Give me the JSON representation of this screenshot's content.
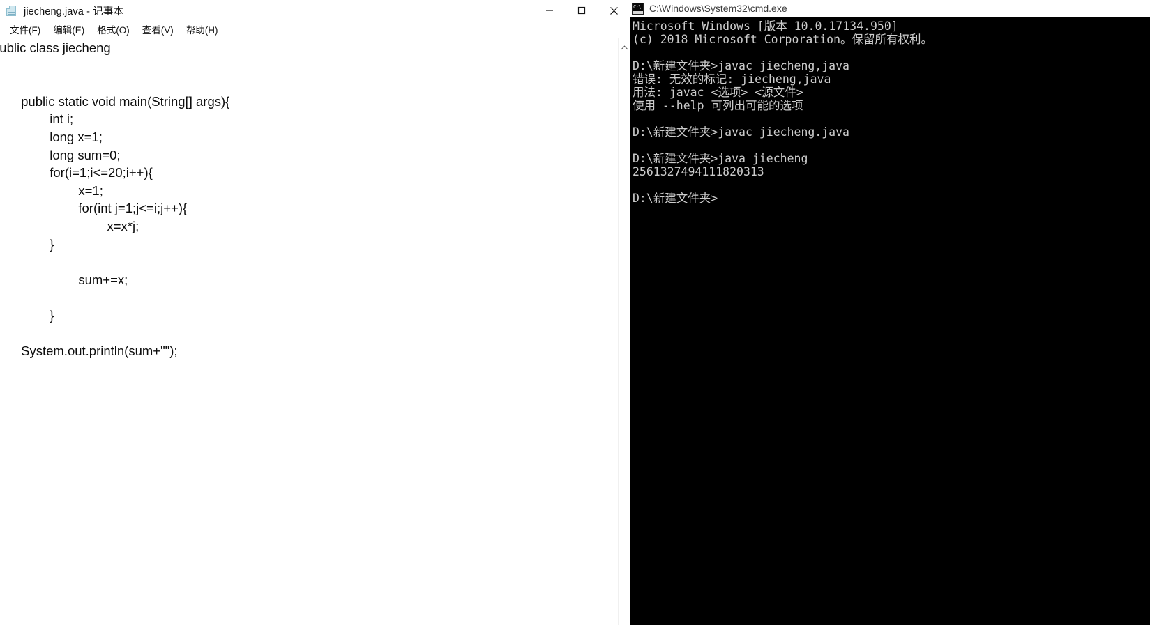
{
  "notepad": {
    "icon": "notepad-document-icon",
    "title": "jiecheng.java - 记事本",
    "window_buttons": {
      "minimize_label": "—",
      "maximize_label": "□",
      "close_label": "✕"
    },
    "menu": [
      {
        "label": "文件(F)"
      },
      {
        "label": "编辑(E)"
      },
      {
        "label": "格式(O)"
      },
      {
        "label": "查看(V)"
      },
      {
        "label": "帮助(H)"
      }
    ],
    "editor": {
      "scrolled_horizontally": true,
      "lines": [
        "public class jiecheng",
        "{",
        "",
        "        public static void main(String[] args){",
        "                int i;",
        "                long x=1;",
        "                long sum=0;",
        "                for(i=1;i<=20;i++){",
        "                        x=1;",
        "                        for(int j=1;j<=i;j++){",
        "                                x=x*j;",
        "                }",
        "",
        "                        sum+=x;",
        "",
        "                }",
        "",
        "        System.out.println(sum+\"\");",
        "",
        "",
        "}",
        "",
        "}"
      ],
      "caret_line_index": 7,
      "caret_after_text": "for(i=1;i<=20;i++){"
    },
    "scrollbar": {
      "up_arrow": "chevron-up-icon"
    }
  },
  "cmd": {
    "icon": "cmd-console-icon",
    "title": "C:\\Windows\\System32\\cmd.exe",
    "lines": [
      "Microsoft Windows [版本 10.0.17134.950]",
      "(c) 2018 Microsoft Corporation。保留所有权利。",
      "",
      "D:\\新建文件夹>javac jiecheng,java",
      "错误: 无效的标记: jiecheng,java",
      "用法: javac <选项> <源文件>",
      "使用 --help 可列出可能的选项",
      "",
      "D:\\新建文件夹>javac jiecheng.java",
      "",
      "D:\\新建文件夹>java jiecheng",
      "2561327494111820313",
      "",
      "D:\\新建文件夹>"
    ],
    "colors": {
      "background": "#000000",
      "foreground": "#cccccc"
    }
  }
}
